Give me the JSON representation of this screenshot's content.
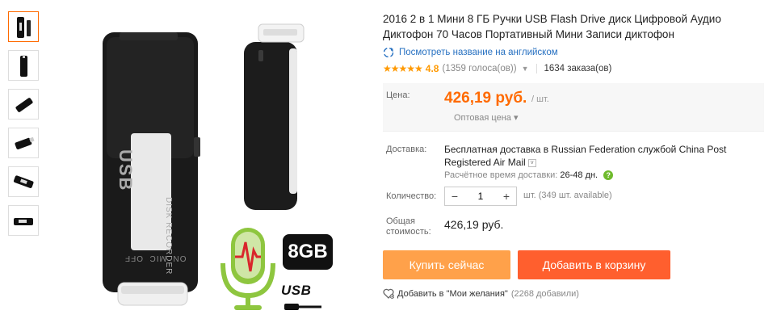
{
  "product": {
    "title": "2016 2 в 1 Мини 8 ГБ Ручки USB Flash Drive диск Цифровой Аудио Диктофон 70 Часов Портативный Мини Записи диктофон",
    "translate_link": "Посмотреть название на английском",
    "rating": {
      "stars": "★★★★★",
      "score": "4.8",
      "votes": "(1359 голоса(ов))",
      "orders": "1634 заказа(ов)"
    }
  },
  "price": {
    "label": "Цена:",
    "value": "426,19 руб.",
    "unit": "/ шт.",
    "wholesale": "Оптовая цена ▾"
  },
  "shipping": {
    "label": "Доставка:",
    "text": "Бесплатная доставка в Russian Federation службой China Post Registered Air Mail",
    "time_label": "Расчётное время доставки:",
    "time_value": "26-48 дн."
  },
  "quantity": {
    "label": "Количество:",
    "value": "1",
    "minus": "−",
    "plus": "+",
    "available": "шт. (349 шт. available)"
  },
  "total": {
    "label": "Общая стоимость:",
    "value": "426,19 руб."
  },
  "actions": {
    "buy_now": "Купить сейчас",
    "add_to_cart": "Добавить в корзину",
    "wishlist": "Добавить в \"Мои желания\"",
    "wishlist_count": "(2268 добавили)"
  },
  "image_badges": {
    "capacity": "8GB",
    "interface": "USB"
  },
  "device_labels": {
    "brand": "USB",
    "subtitle": "DISK RECORDER",
    "switch": "ON  MIC  OFF"
  },
  "colors": {
    "price": "#ff6a00",
    "buy_now": "#ffa14a",
    "add_to_cart": "#ff5f2e",
    "stars": "#ff9900",
    "link": "#2670c1"
  }
}
